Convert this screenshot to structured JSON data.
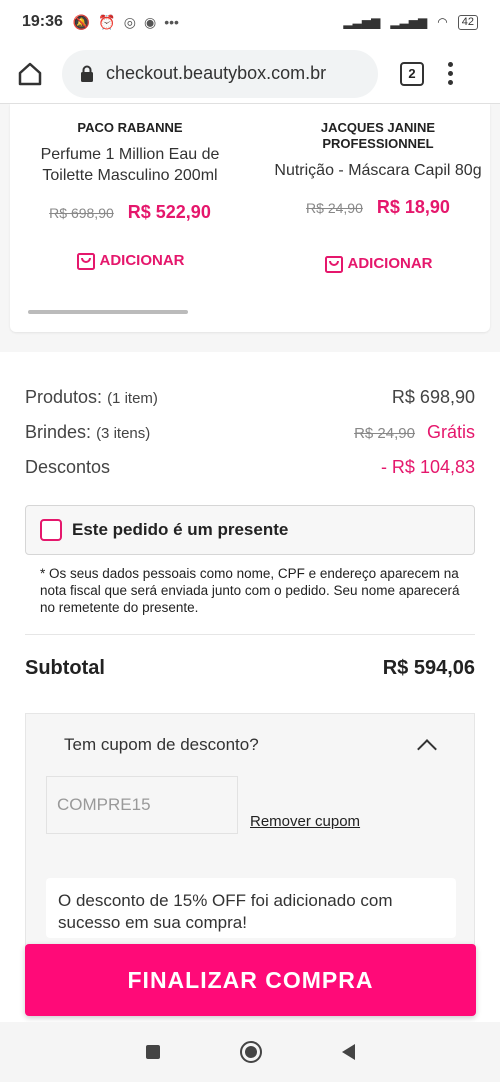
{
  "status_bar": {
    "time": "19:36",
    "battery": "42"
  },
  "browser": {
    "url": "checkout.beautybox.com.br",
    "tab_count": "2"
  },
  "products": [
    {
      "brand": "PACO RABANNE",
      "name": "Perfume 1 Million Eau de Toilette Masculino 200ml",
      "old_price": "R$ 698,90",
      "price": "R$ 522,90",
      "add_label": "ADICIONAR"
    },
    {
      "brand": "JACQUES JANINE PROFESSIONNEL",
      "name": "Nutrição - Máscara Capil 80g",
      "old_price": "R$ 24,90",
      "price": "R$ 18,90",
      "add_label": "ADICIONAR"
    }
  ],
  "summary": {
    "produtos_label": "Produtos:",
    "produtos_count": "(1 item)",
    "produtos_value": "R$ 698,90",
    "brindes_label": "Brindes:",
    "brindes_count": "(3 itens)",
    "brindes_old": "R$ 24,90",
    "brindes_value": "Grátis",
    "descontos_label": "Descontos",
    "descontos_value": "- R$ 104,83"
  },
  "gift": {
    "label": "Este pedido é um presente",
    "note": "* Os seus dados pessoais como nome, CPF e endereço aparecem na nota fiscal que será enviada junto com o pedido. Seu nome aparecerá no remetente do presente."
  },
  "subtotal": {
    "label": "Subtotal",
    "value": "R$ 594,06"
  },
  "coupon": {
    "title": "Tem cupom de desconto?",
    "value": "COMPRE15",
    "remove_label": "Remover cupom",
    "success": "O desconto de 15% OFF foi adicionado com sucesso em sua compra!"
  },
  "cta": {
    "label": "FINALIZAR COMPRA"
  },
  "colors": {
    "accent": "#e5176c",
    "cta": "#ff0a78"
  }
}
